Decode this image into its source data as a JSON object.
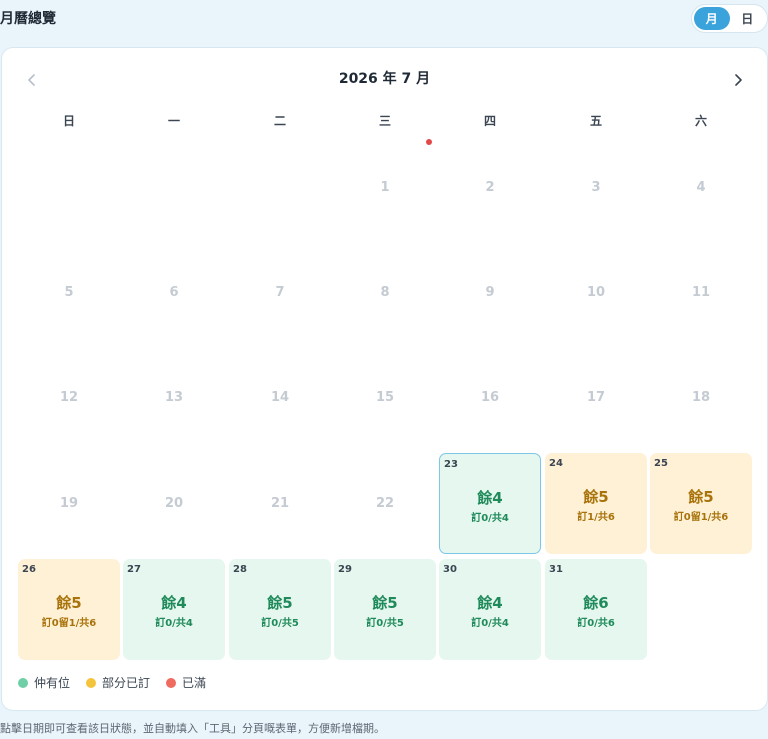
{
  "header": {
    "title": "月曆總覽"
  },
  "view_toggle": {
    "month": "月",
    "day": "日",
    "active": "month"
  },
  "calendar": {
    "month_title": "2026 年 7 月",
    "weekdays": [
      "日",
      "一",
      "二",
      "三",
      "四",
      "五",
      "六"
    ],
    "inactive_days": [
      "1",
      "2",
      "3",
      "4",
      "5",
      "6",
      "7",
      "8",
      "9",
      "10",
      "11",
      "12",
      "13",
      "14",
      "15",
      "16",
      "17",
      "18",
      "19",
      "20",
      "21",
      "22"
    ],
    "available_days": [
      {
        "day": "23",
        "main": "餘4",
        "sub": "訂0/共4",
        "status": "available",
        "selected": true
      },
      {
        "day": "24",
        "main": "餘5",
        "sub": "訂1/共6",
        "status": "partial"
      },
      {
        "day": "25",
        "main": "餘5",
        "sub": "訂0留1/共6",
        "status": "partial"
      },
      {
        "day": "26",
        "main": "餘5",
        "sub": "訂0留1/共6",
        "status": "partial"
      },
      {
        "day": "27",
        "main": "餘4",
        "sub": "訂0/共4",
        "status": "available"
      },
      {
        "day": "28",
        "main": "餘5",
        "sub": "訂0/共5",
        "status": "available"
      },
      {
        "day": "29",
        "main": "餘5",
        "sub": "訂0/共5",
        "status": "available"
      },
      {
        "day": "30",
        "main": "餘4",
        "sub": "訂0/共4",
        "status": "available"
      },
      {
        "day": "31",
        "main": "餘6",
        "sub": "訂0/共6",
        "status": "available"
      }
    ]
  },
  "legend": [
    {
      "label": "仲有位",
      "color": "#6fcfa6"
    },
    {
      "label": "部分已訂",
      "color": "#f5c43d"
    },
    {
      "label": "已滿",
      "color": "#ef6a5f"
    }
  ],
  "footer": {
    "hint": "點擊日期即可查看該日狀態，並自動填入「工具」分頁嘅表單，方便新增檔期。"
  }
}
